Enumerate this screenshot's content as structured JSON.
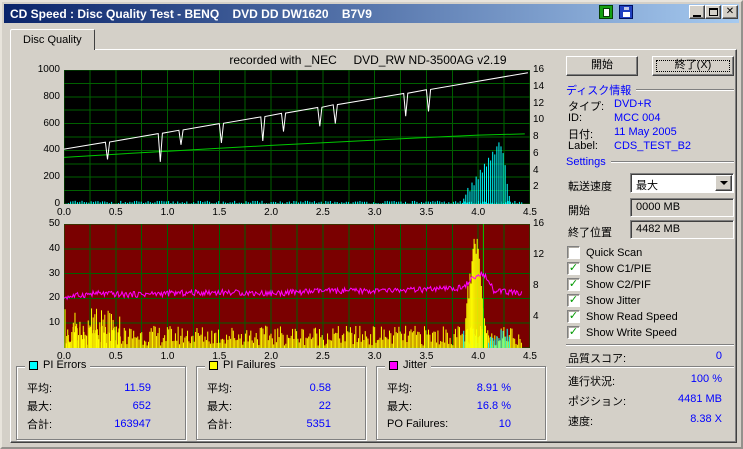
{
  "window": {
    "title": "CD Speed : Disc Quality Test - BENQ    DVD DD DW1620    B7V9",
    "tab_label": "Disc Quality"
  },
  "note": "recorded with _NEC     DVD_RW ND-3500AG v2.19",
  "buttons": {
    "start": "開始",
    "exit": "終了(X)"
  },
  "disc_info": {
    "header": "ディスク情報",
    "rows": [
      {
        "label": "タイプ:",
        "value": "DVD+R"
      },
      {
        "label": "ID:",
        "value": "MCC 004"
      },
      {
        "label": "日付:",
        "value": "11 May 2005"
      },
      {
        "label": "Label:",
        "value": "CDS_TEST_B2"
      }
    ]
  },
  "settings": {
    "header": "Settings",
    "speed_label": "転送速度",
    "speed_value": "最大",
    "start_label": "開始",
    "start_value": "0000 MB",
    "end_label": "終了位置",
    "end_value": "4482 MB"
  },
  "checkboxes": [
    {
      "label": "Quick Scan",
      "checked": false
    },
    {
      "label": "Show C1/PIE",
      "checked": true
    },
    {
      "label": "Show C2/PIF",
      "checked": true
    },
    {
      "label": "Show Jitter",
      "checked": true
    },
    {
      "label": "Show Read Speed",
      "checked": true
    },
    {
      "label": "Show Write Speed",
      "checked": true
    }
  ],
  "quality_score": {
    "label": "品質スコア:",
    "value": "0"
  },
  "status_rows": [
    {
      "label": "進行状況:",
      "value": "100 %"
    },
    {
      "label": "ポジション:",
      "value": "4481 MB"
    },
    {
      "label": "速度:",
      "value": "8.38 X"
    }
  ],
  "legends": [
    {
      "title": "PI Errors",
      "color": "#00FFFF",
      "rows": [
        {
          "label": "平均:",
          "value": "11.59"
        },
        {
          "label": "最大:",
          "value": "652"
        },
        {
          "label": "合計:",
          "value": "163947"
        }
      ]
    },
    {
      "title": "PI Failures",
      "color": "#FFFF00",
      "rows": [
        {
          "label": "平均:",
          "value": "0.58"
        },
        {
          "label": "最大:",
          "value": "22"
        },
        {
          "label": "合計:",
          "value": "5351"
        }
      ]
    },
    {
      "title": "Jitter",
      "color": "#FF00FF",
      "rows": [
        {
          "label": "平均:",
          "value": "8.91 %"
        },
        {
          "label": "最大:",
          "value": "16.8 %"
        },
        {
          "label": "PO Failures:",
          "value": "10"
        }
      ]
    }
  ],
  "chart_data": [
    {
      "type": "line",
      "name": "pi-errors-and-speed",
      "bg": "#000000",
      "grid_color": "#006000",
      "x_range": [
        0,
        4.5
      ],
      "x_grid_step": 0.25,
      "y_left_range": [
        0,
        1000
      ],
      "y_grid_step": 100,
      "y_right_range": [
        0,
        16
      ],
      "x_ticks": [
        "0.0",
        "0.5",
        "1.0",
        "1.5",
        "2.0",
        "2.5",
        "3.0",
        "3.5",
        "4.0",
        "4.5"
      ],
      "y_left_ticks": [
        1000,
        800,
        600,
        400,
        200,
        0
      ],
      "y_right_ticks": [
        16,
        14,
        12,
        10,
        8,
        6,
        4,
        2
      ],
      "noise": [
        {
          "name": "pie-base",
          "color": "#00FFFF",
          "x0": 0.02,
          "x1": 4.42,
          "step": 0.022,
          "hmin": 2,
          "hmax": 24,
          "seed": 11
        }
      ],
      "spikes": [
        {
          "name": "pie-burst",
          "color": "#00FFFF",
          "points": [
            [
              3.86,
              40
            ],
            [
              3.88,
              70
            ],
            [
              3.9,
              120
            ],
            [
              3.92,
              95
            ],
            [
              3.94,
              160
            ],
            [
              3.96,
              140
            ],
            [
              3.98,
              205
            ],
            [
              4.0,
              185
            ],
            [
              4.02,
              255
            ],
            [
              4.04,
              235
            ],
            [
              4.06,
              300
            ],
            [
              4.08,
              280
            ],
            [
              4.1,
              345
            ],
            [
              4.12,
              325
            ],
            [
              4.14,
              390
            ],
            [
              4.16,
              370
            ],
            [
              4.18,
              430
            ],
            [
              4.2,
              460
            ],
            [
              4.22,
              430
            ],
            [
              4.24,
              380
            ],
            [
              4.26,
              290
            ],
            [
              4.28,
              150
            ],
            [
              4.3,
              60
            ]
          ]
        }
      ],
      "series": [
        {
          "name": "read-speed",
          "color": "#00C800",
          "width": 1,
          "points": [
            [
              0,
              348
            ],
            [
              0.5,
              372
            ],
            [
              1,
              394
            ],
            [
              1.5,
              416
            ],
            [
              2,
              437
            ],
            [
              2.5,
              457
            ],
            [
              3,
              477
            ],
            [
              3.5,
              496
            ],
            [
              4,
              514
            ],
            [
              4.45,
              523
            ]
          ]
        },
        {
          "name": "write-speed",
          "color": "#FFFFFF",
          "width": 1,
          "points": [
            [
              0,
              410
            ],
            [
              0.4,
              461
            ],
            [
              0.42,
              333
            ],
            [
              0.44,
              463
            ],
            [
              0.91,
              525
            ],
            [
              0.93,
              315
            ],
            [
              0.95,
              528
            ],
            [
              1.11,
              550
            ],
            [
              1.13,
              442
            ],
            [
              1.15,
              553
            ],
            [
              1.5,
              600
            ],
            [
              1.52,
              455
            ],
            [
              1.54,
              602
            ],
            [
              1.9,
              650
            ],
            [
              1.92,
              470
            ],
            [
              1.94,
              653
            ],
            [
              2.1,
              676
            ],
            [
              2.12,
              540
            ],
            [
              2.14,
              678
            ],
            [
              2.45,
              720
            ],
            [
              2.47,
              580
            ],
            [
              2.49,
              722
            ],
            [
              2.6,
              740
            ],
            [
              2.62,
              600
            ],
            [
              2.64,
              742
            ],
            [
              3.28,
              825
            ],
            [
              3.3,
              655
            ],
            [
              3.32,
              827
            ],
            [
              3.5,
              853
            ],
            [
              3.52,
              690
            ],
            [
              3.54,
              855
            ],
            [
              4.48,
              980
            ]
          ]
        }
      ]
    },
    {
      "type": "line",
      "name": "pi-failures-and-jitter",
      "bg": "#7A0000",
      "grid_color": "#006000",
      "x_range": [
        0,
        4.5
      ],
      "x_grid_step": 0.25,
      "y_left_range": [
        0,
        50
      ],
      "y_grid_step": 10,
      "y_right_range": [
        0,
        16
      ],
      "x_ticks": [
        "0.0",
        "0.5",
        "1.0",
        "1.5",
        "2.0",
        "2.5",
        "3.0",
        "3.5",
        "4.0",
        "4.5"
      ],
      "y_left_ticks": [
        50,
        40,
        30,
        20,
        10
      ],
      "y_right_ticks": [
        16,
        12,
        8,
        4
      ],
      "noise": [
        {
          "name": "pif-base",
          "color": "#FFFF00",
          "x0": 0.01,
          "x1": 4.42,
          "step": 0.013,
          "hmin": 1,
          "hmax": 9,
          "seed": 5
        },
        {
          "name": "pif-early",
          "color": "#FFFF00",
          "x0": 0.01,
          "x1": 0.55,
          "step": 0.016,
          "hmin": 2,
          "hmax": 16,
          "seed": 8
        },
        {
          "name": "pif-late",
          "color": "#FFFF00",
          "x0": 4.1,
          "x1": 4.3,
          "step": 0.02,
          "hmin": 1,
          "hmax": 6,
          "seed": 6
        },
        {
          "name": "pie-burst-small",
          "color": "#00FFFF",
          "x0": 3.86,
          "x1": 4.3,
          "step": 0.02,
          "hmin": 2,
          "hmax": 8,
          "seed": 4
        }
      ],
      "spikes": [
        {
          "name": "pif-burst",
          "color": "#FFFF00",
          "points": [
            [
              3.88,
              12
            ],
            [
              3.89,
              18
            ],
            [
              3.9,
              25
            ],
            [
              3.91,
              20
            ],
            [
              3.92,
              30
            ],
            [
              3.93,
              26
            ],
            [
              3.94,
              35
            ],
            [
              3.95,
              40
            ],
            [
              3.96,
              44
            ],
            [
              3.97,
              42
            ],
            [
              3.98,
              38
            ],
            [
              3.99,
              44
            ],
            [
              4.0,
              40
            ],
            [
              4.01,
              36
            ],
            [
              4.02,
              30
            ],
            [
              4.03,
              25
            ],
            [
              4.04,
              20
            ],
            [
              4.05,
              16
            ],
            [
              4.06,
              12
            ],
            [
              4.07,
              9
            ],
            [
              4.08,
              6
            ]
          ]
        }
      ],
      "vlines": [
        {
          "name": "speed-drop-marker",
          "color": "#00C800",
          "x": 4.05
        }
      ],
      "series": [
        {
          "name": "jitter",
          "color": "#FF00FF",
          "width": 1,
          "points": [
            [
              0,
              20.5
            ],
            [
              0.3,
              22
            ],
            [
              0.6,
              21.5
            ],
            [
              1,
              22
            ],
            [
              1.5,
              22.5
            ],
            [
              2,
              22
            ],
            [
              2.5,
              23
            ],
            [
              3,
              23
            ],
            [
              3.5,
              23.5
            ],
            [
              3.8,
              24
            ],
            [
              3.9,
              26
            ],
            [
              3.95,
              28
            ],
            [
              4.0,
              29
            ],
            [
              4.05,
              30
            ],
            [
              4.1,
              28
            ],
            [
              4.15,
              23
            ],
            [
              4.3,
              22.5
            ],
            [
              4.42,
              22
            ]
          ],
          "noise": {
            "x0": 0,
            "x1": 4.42,
            "step": 0.01,
            "amp": 1.2,
            "seed": 9
          }
        }
      ]
    }
  ]
}
